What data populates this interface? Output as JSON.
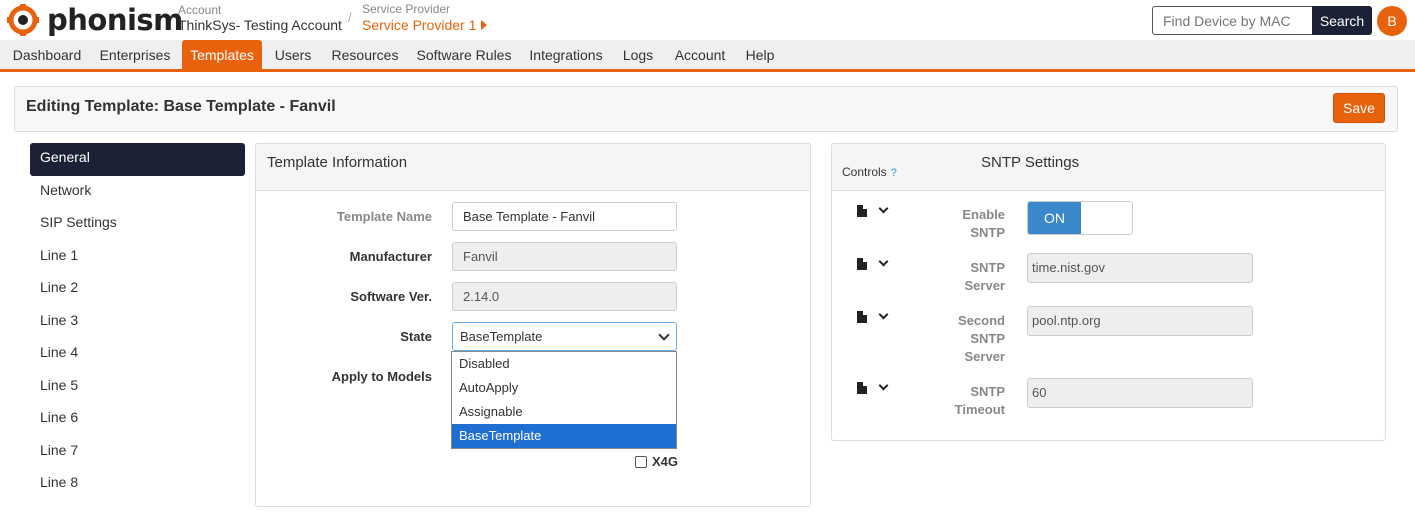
{
  "brand": {
    "name": "phonism",
    "accent": "#e8620e",
    "dark": "#1b2236"
  },
  "header": {
    "account_label": "Account",
    "account_value": "ThinkSys- Testing Account",
    "separator": "/",
    "sp_label": "Service Provider",
    "sp_value": "Service Provider 1",
    "search_placeholder": "Find Device by MAC",
    "search_button": "Search",
    "avatar_initial": "B"
  },
  "nav": {
    "items": [
      {
        "label": "Dashboard"
      },
      {
        "label": "Enterprises"
      },
      {
        "label": "Templates",
        "active": true
      },
      {
        "label": "Users"
      },
      {
        "label": "Resources"
      },
      {
        "label": "Software Rules"
      },
      {
        "label": "Integrations"
      },
      {
        "label": "Logs"
      },
      {
        "label": "Account"
      },
      {
        "label": "Help"
      }
    ]
  },
  "page": {
    "title": "Editing Template: Base Template - Fanvil",
    "save_label": "Save"
  },
  "sidebar": {
    "items": [
      {
        "label": "General",
        "active": true
      },
      {
        "label": "Network"
      },
      {
        "label": "SIP Settings"
      },
      {
        "label": "Line 1"
      },
      {
        "label": "Line 2"
      },
      {
        "label": "Line 3"
      },
      {
        "label": "Line 4"
      },
      {
        "label": "Line 5"
      },
      {
        "label": "Line 6"
      },
      {
        "label": "Line 7"
      },
      {
        "label": "Line 8"
      }
    ]
  },
  "template_info": {
    "title": "Template Information",
    "name_label": "Template Name",
    "name_value": "Base Template - Fanvil",
    "manufacturer_label": "Manufacturer",
    "manufacturer_value": "Fanvil",
    "software_label": "Software Ver.",
    "software_value": "2.14.0",
    "state_label": "State",
    "state_value": "BaseTemplate",
    "state_options": [
      "Disabled",
      "AutoApply",
      "Assignable",
      "BaseTemplate"
    ],
    "models_label": "Apply to Models",
    "model_checkbox": "X4G"
  },
  "sntp": {
    "controls_label": "Controls",
    "help_mark": "?",
    "title": "SNTP Settings",
    "enable_label_1": "Enable",
    "enable_label_2": "SNTP",
    "enable_value": "ON",
    "server_label_1": "SNTP",
    "server_label_2": "Server",
    "server_value": "time.nist.gov",
    "second_label_1": "Second",
    "second_label_2": "SNTP",
    "second_label_3": "Server",
    "second_value": "pool.ntp.org",
    "timeout_label_1": "SNTP",
    "timeout_label_2": "Timeout",
    "timeout_value": "60"
  }
}
